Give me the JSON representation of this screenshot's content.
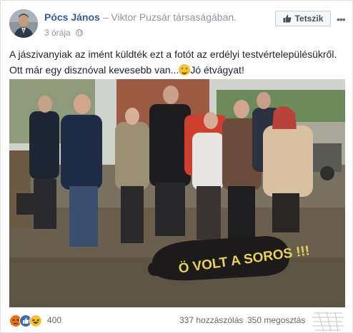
{
  "post": {
    "author_name": "Pócs János",
    "with_prefix": " – ",
    "with_person": "Viktor Puzsár",
    "with_suffix": " társaságában.",
    "time": "3 órája",
    "privacy_icon": "globe-icon",
    "text_line1": "A jászivanyiak az imént küldték ezt a fotót az erdélyi testvértelepülésükről.",
    "text_line2_before": "Ott már egy disznóval kevesebb van...",
    "text_line2_after": "Jó étvágyat!",
    "emoji": "smiling-face-emoji",
    "image_caption_painted": "Ö VOLT A SOROS !!!"
  },
  "actions": {
    "like_page_label": "Tetszik",
    "like_page_icon": "thumbs-up-icon",
    "options_icon": "more-options-icon"
  },
  "footer": {
    "reactions": [
      "angry-reaction-icon",
      "like-reaction-icon",
      "haha-reaction-icon"
    ],
    "reaction_count": "400",
    "comments": "337 hozzászólás",
    "shares": "350 megosztás"
  },
  "colors": {
    "link_blue": "#365899",
    "meta_gray": "#90949c",
    "like_blue": "#4267b2",
    "angry": "#e9710f",
    "haha": "#f7c137"
  }
}
